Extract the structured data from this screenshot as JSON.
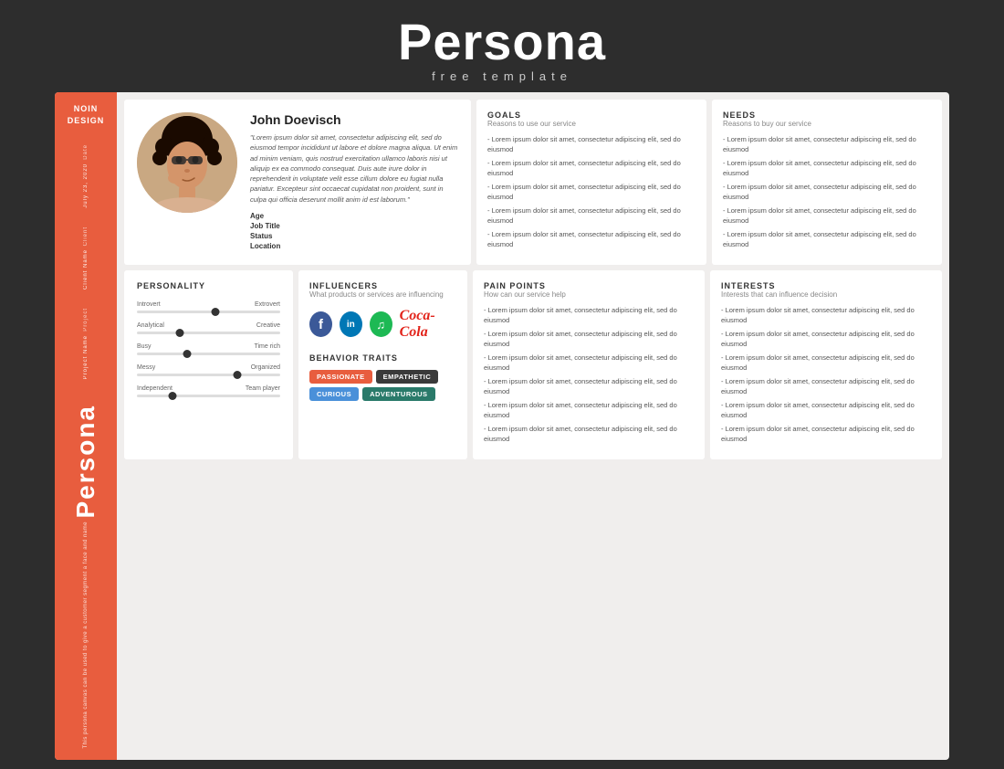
{
  "header": {
    "title": "Persona",
    "subtitle": "free  template"
  },
  "sidebar": {
    "brand_line1": "NOIN",
    "brand_line2": "DESIGN",
    "date_label": "Date",
    "date_value": "July 23, 2020",
    "client_label": "Client",
    "client_value": "Client Name",
    "project_label": "Project",
    "project_value": "Project Name",
    "persona_label": "Persona",
    "description": "This persona canvas can be used to give a customer segment a face and name"
  },
  "profile": {
    "name": "John Doevisch",
    "bio": "\"Lorem ipsum dolor sit amet, consectetur adipiscing elit, sed do eiusmod tempor incididunt ut labore et dolore magna aliqua. Ut enim ad minim veniam, quis nostrud exercitation ullamco laboris nisi ut aliquip ex ea commodo consequat. Duis aute irure dolor in reprehenderit in voluptate velit esse cillum dolore eu fugiat nulla pariatur. Excepteur sint occaecat cupidatat non proident, sunt in culpa qui officia deserunt mollit anim id est laborum.\"",
    "fields": [
      {
        "label": "Age"
      },
      {
        "label": "Job Title"
      },
      {
        "label": "Status"
      },
      {
        "label": "Location"
      }
    ]
  },
  "goals": {
    "title": "GOALS",
    "subtitle": "Reasons to use our service",
    "items": [
      "- Lorem ipsum dolor sit amet, consectetur adipiscing elit, sed do eiusmod",
      "- Lorem ipsum dolor sit amet, consectetur adipiscing elit, sed do eiusmod",
      "- Lorem ipsum dolor sit amet, consectetur adipiscing elit, sed do eiusmod",
      "- Lorem ipsum dolor sit amet, consectetur adipiscing elit, sed do eiusmod",
      "- Lorem ipsum dolor sit amet, consectetur adipiscing elit, sed do eiusmod"
    ]
  },
  "needs": {
    "title": "NEEDS",
    "subtitle": "Reasons to buy our service",
    "items": [
      "- Lorem ipsum dolor sit amet, consectetur adipiscing elit, sed do eiusmod",
      "- Lorem ipsum dolor sit amet, consectetur adipiscing elit, sed do eiusmod",
      "- Lorem ipsum dolor sit amet, consectetur adipiscing elit, sed do eiusmod",
      "- Lorem ipsum dolor sit amet, consectetur adipiscing elit, sed do eiusmod",
      "- Lorem ipsum dolor sit amet, consectetur adipiscing elit, sed do eiusmod"
    ]
  },
  "personality": {
    "title": "PERSONALITY",
    "traits": [
      {
        "left": "Introvert",
        "right": "Extrovert",
        "position": 55
      },
      {
        "left": "Analytical",
        "right": "Creative",
        "position": 30
      },
      {
        "left": "Busy",
        "right": "Time rich",
        "position": 35
      },
      {
        "left": "Messy",
        "right": "Organized",
        "position": 70
      },
      {
        "left": "Independent",
        "right": "Team player",
        "position": 25
      }
    ]
  },
  "influencers": {
    "title": "INFLUENCERS",
    "subtitle": "What products or services are influencing",
    "icons": [
      {
        "name": "facebook",
        "symbol": "f",
        "color": "#3b5998"
      },
      {
        "name": "linkedin",
        "symbol": "in",
        "color": "#0077b5"
      },
      {
        "name": "spotify",
        "symbol": "♪",
        "color": "#1db954"
      }
    ],
    "coca_cola": "Coca-Cola"
  },
  "behavior_traits": {
    "title": "BEHAVIOR TRAITS",
    "tags": [
      {
        "label": "PASSIONATE",
        "color": "orange"
      },
      {
        "label": "EMPATHETIC",
        "color": "dark"
      },
      {
        "label": "CURIOUS",
        "color": "blue"
      },
      {
        "label": "ADVENTUROUS",
        "color": "teal"
      }
    ]
  },
  "pain_points": {
    "title": "PAIN POINTS",
    "subtitle": "How can our service help",
    "items": [
      "- Lorem ipsum dolor sit amet, consectetur adipiscing elit, sed do eiusmod",
      "- Lorem ipsum dolor sit amet, consectetur adipiscing elit, sed do eiusmod",
      "- Lorem ipsum dolor sit amet, consectetur adipiscing elit, sed do eiusmod",
      "- Lorem ipsum dolor sit amet, consectetur adipiscing elit, sed do eiusmod",
      "- Lorem ipsum dolor sit amet, consectetur adipiscing elit, sed do eiusmod",
      "- Lorem ipsum dolor sit amet, consectetur adipiscing elit, sed do eiusmod"
    ]
  },
  "interests": {
    "title": "INTERESTS",
    "subtitle": "Interests that can influence decision",
    "items": [
      "- Lorem ipsum dolor sit amet, consectetur adipiscing elit, sed do eiusmod",
      "- Lorem ipsum dolor sit amet, consectetur adipiscing elit, sed do eiusmod",
      "- Lorem ipsum dolor sit amet, consectetur adipiscing elit, sed do eiusmod",
      "- Lorem ipsum dolor sit amet, consectetur adipiscing elit, sed do eiusmod",
      "- Lorem ipsum dolor sit amet, consectetur adipiscing elit, sed do eiusmod",
      "- Lorem ipsum dolor sit amet, consectetur adipiscing elit, sed do eiusmod"
    ]
  }
}
